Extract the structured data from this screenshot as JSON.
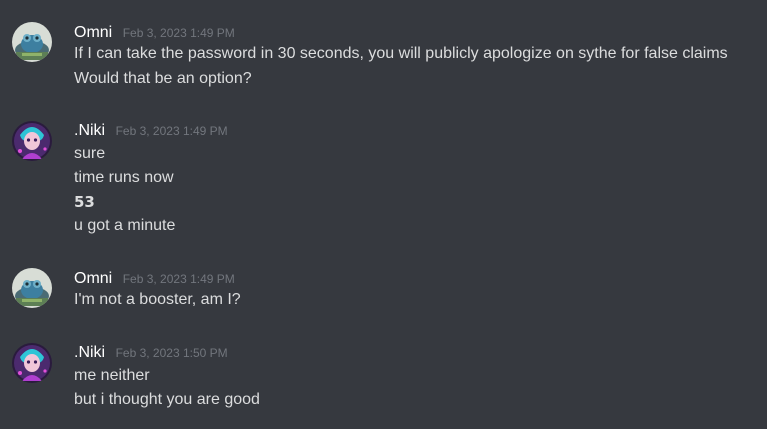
{
  "messages": [
    {
      "author": "Omni",
      "timestamp": "Feb 3, 2023 1:49 PM",
      "avatar_icon": "omni-avatar-icon",
      "lines": [
        "If I can take the password in 30 seconds, you will publicly apologize on sythe for false claims",
        "Would that be an option?"
      ]
    },
    {
      "author": ".Niki",
      "timestamp": "Feb 3, 2023 1:49 PM",
      "avatar_icon": "niki-avatar-icon",
      "lines": [
        "sure",
        "time runs now",
        "53",
        "u got a minute"
      ]
    },
    {
      "author": "Omni",
      "timestamp": "Feb 3, 2023 1:49 PM",
      "avatar_icon": "omni-avatar-icon",
      "lines": [
        "I'm not a booster, am I?"
      ]
    },
    {
      "author": ".Niki",
      "timestamp": "Feb 3, 2023 1:50 PM",
      "avatar_icon": "niki-avatar-icon",
      "lines": [
        "me neither",
        "but i thought you are good"
      ]
    }
  ],
  "colors": {
    "background": "#36393f",
    "username": "#ffffff",
    "timestamp": "#72767d",
    "text": "#dcddde"
  }
}
